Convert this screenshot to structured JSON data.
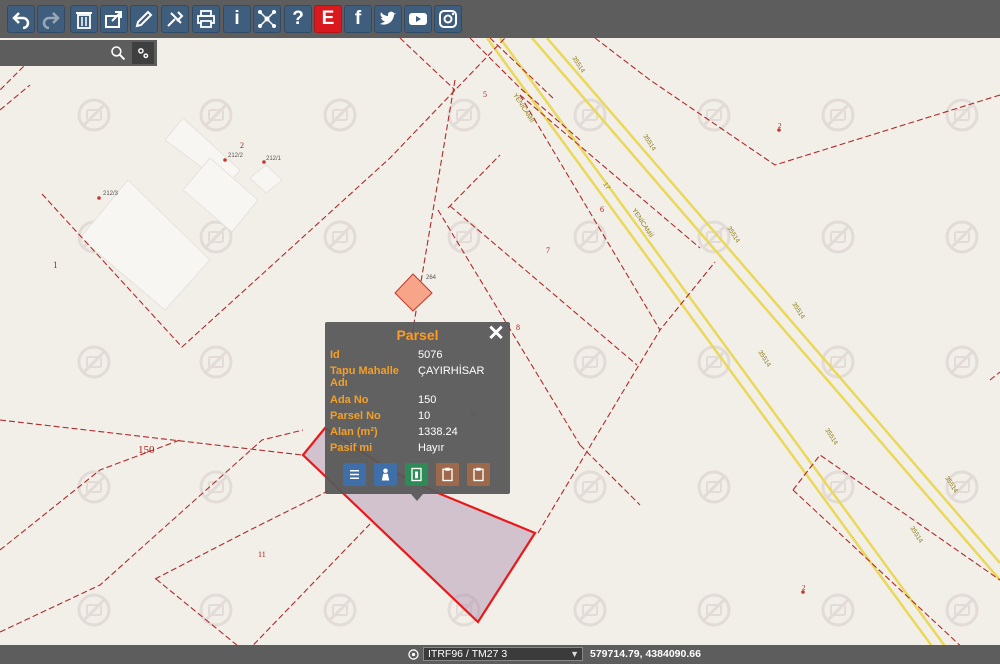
{
  "toolbar": {
    "buttons": [
      {
        "icon": "undo-icon"
      },
      {
        "icon": "redo-icon"
      },
      {
        "icon": "trash-icon"
      },
      {
        "icon": "share-icon"
      },
      {
        "icon": "pencil-icon"
      },
      {
        "icon": "tools-icon"
      },
      {
        "icon": "print-icon"
      },
      {
        "icon": "info-icon",
        "glyph": "i"
      },
      {
        "icon": "network-icon"
      },
      {
        "icon": "help-icon",
        "glyph": "?"
      },
      {
        "icon": "e-icon",
        "glyph": "E"
      },
      {
        "icon": "facebook-icon",
        "glyph": "f"
      },
      {
        "icon": "twitter-icon"
      },
      {
        "icon": "youtube-icon"
      },
      {
        "icon": "instagram-icon"
      }
    ]
  },
  "colors": {
    "parcel_line": "#b02a2a",
    "highlight": "#e8191b",
    "road_yellow": "#e9d85a",
    "popup_label": "#f2a02a",
    "popup_title": "#ff9b22"
  },
  "map_labels": {
    "parcel_150": "150",
    "parcel_1": "1",
    "parcel_2": "2",
    "parcel_2b": "2",
    "parcel_2c": "2",
    "parcel_5": "5",
    "parcel_6": "6",
    "parcel_7": "7",
    "parcel_8": "8",
    "parcel_9": "9",
    "parcel_11": "11",
    "parcel_12": "12",
    "building_212_2": "212/2",
    "building_212_1": "212/1",
    "building_212_3": "212/3",
    "building_264": "264",
    "road_35514_a": "35514",
    "road_35514_b": "35514",
    "road_35514_c": "35514",
    "road_35514_d": "35514",
    "road_35514_e": "35514",
    "road_35514_f": "35514",
    "road_35514_g": "35514",
    "road_yenicamii_a": "YENİCAMİİ",
    "road_yenicamii_b": "YENİCAMİİ",
    "road_17": "17"
  },
  "popup": {
    "title": "Parsel",
    "rows": [
      {
        "label": "Id",
        "value": "5076"
      },
      {
        "label": "Tapu Mahalle Adı",
        "value": "ÇAYIRHİSAR"
      },
      {
        "label": "Ada No",
        "value": "150"
      },
      {
        "label": "Parsel No",
        "value": "10"
      },
      {
        "label": "Alan (m²)",
        "value": "1338.24"
      },
      {
        "label": "Pasif mi",
        "value": "Hayır"
      }
    ],
    "actions": [
      {
        "icon": "list-icon",
        "color": "#3f6fa8"
      },
      {
        "icon": "person-icon",
        "color": "#3f6fa8"
      },
      {
        "icon": "document-icon",
        "color": "#2e8b57"
      },
      {
        "icon": "clipboard-icon",
        "color": "#9c6a4a"
      },
      {
        "icon": "clipboard-icon",
        "color": "#9c6a4a"
      }
    ]
  },
  "statusbar": {
    "crs": "ITRF96 / TM27 3",
    "coords": "579714.79, 4384090.66"
  }
}
